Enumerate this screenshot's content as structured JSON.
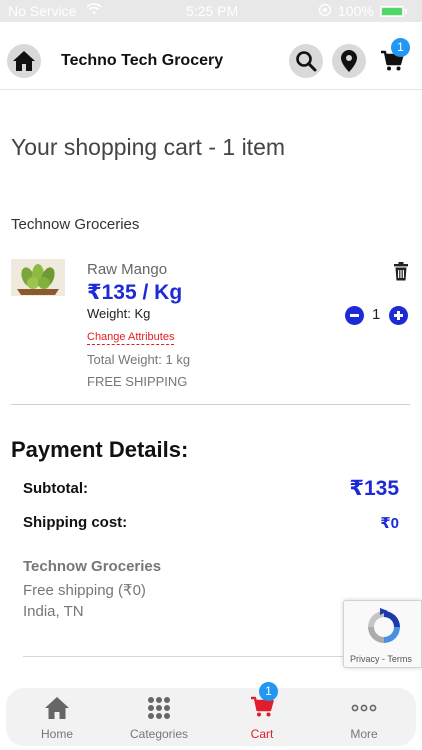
{
  "status_bar": {
    "carrier": "No Service",
    "time": "5:25 PM",
    "battery": "100%"
  },
  "header": {
    "title": "Techno Tech Grocery",
    "cart_count": "1"
  },
  "page": {
    "heading": "Your shopping cart - 1 item",
    "store_name": "Technow Groceries"
  },
  "cart_item": {
    "name": "Raw Mango",
    "price": "₹135 / Kg",
    "weight": "Weight: Kg",
    "change_attributes": "Change Attributes",
    "total_weight": "Total Weight: 1 kg",
    "shipping": "FREE SHIPPING",
    "quantity": "1"
  },
  "payment": {
    "title": "Payment Details:",
    "subtotal_label": "Subtotal:",
    "subtotal_value": "₹135",
    "shipping_label": "Shipping cost:",
    "shipping_value": "₹0",
    "shipping_store": "Technow Groceries",
    "shipping_method": "Free shipping (₹0)",
    "shipping_location": "India, TN"
  },
  "recaptcha": {
    "text": "Privacy - Terms"
  },
  "bottom_nav": {
    "items": [
      {
        "label": "Home",
        "icon": "home-icon"
      },
      {
        "label": "Categories",
        "icon": "grid-icon"
      },
      {
        "label": "Cart",
        "icon": "cart-icon"
      },
      {
        "label": "More",
        "icon": "more-icon"
      }
    ],
    "cart_badge": "1"
  },
  "colors": {
    "accent": "#1d2ad6",
    "badge": "#2196f3",
    "active_tab": "#e01e2b",
    "link_red": "#e02020"
  }
}
